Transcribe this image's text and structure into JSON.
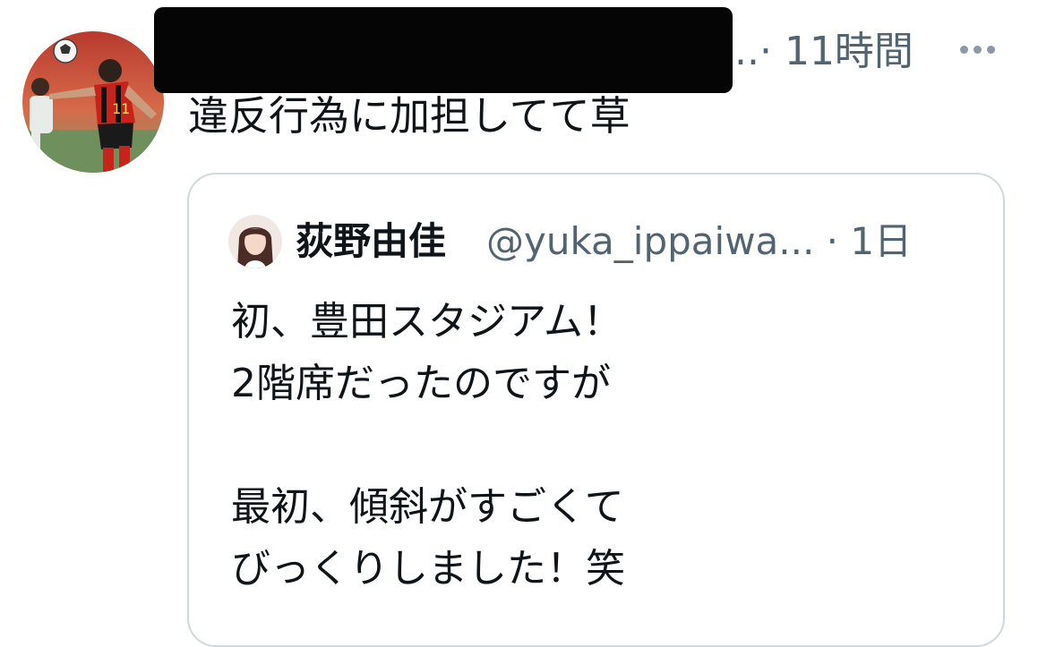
{
  "tweet": {
    "time_meta": "..· 11時間",
    "text": "違反行為に加担してて草",
    "avatar_icon": "soccer-player-avatar",
    "more_icon": "more-horizontal-icon"
  },
  "quote": {
    "author_name": "荻野由佳",
    "handle_meta": "@yuka_ippaiwa... · 1日",
    "avatar_icon": "person-avatar",
    "lines": [
      "初、豊田スタジアム！",
      "2階席だったのですが",
      "",
      "最初、傾斜がすごくて",
      "びっくりしました！笑"
    ]
  },
  "colors": {
    "text": "#0f1419",
    "secondary": "#536471",
    "border": "#cfd9de",
    "redaction": "#050505"
  }
}
